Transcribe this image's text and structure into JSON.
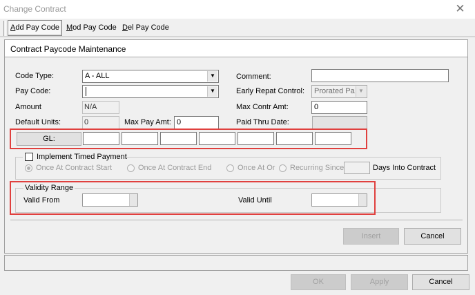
{
  "window": {
    "title": "Change Contract",
    "close_symbol": "✕"
  },
  "toolbar": {
    "add_label": "Add Pay Code",
    "mod_label": "Mod Pay Code",
    "del_label": "Del Pay Code"
  },
  "panel": {
    "title": "Contract Paycode Maintenance"
  },
  "form": {
    "code_type_label": "Code Type:",
    "code_type_value": "A - ALL",
    "pay_code_label": "Pay Code:",
    "pay_code_value": "",
    "amount_label": "Amount",
    "amount_value": "N/A",
    "default_units_label": "Default Units:",
    "default_units_value": "0",
    "max_pay_amt_label": "Max Pay Amt:",
    "max_pay_amt_value": "0",
    "comment_label": "Comment:",
    "comment_value": "",
    "early_repat_label": "Early Repat Control:",
    "early_repat_value": "Prorated Pa",
    "max_contr_amt_label": "Max Contr Amt:",
    "max_contr_amt_value": "0",
    "paid_thru_label": "Paid Thru Date:",
    "paid_thru_value": "",
    "gl_button_label": "GL:",
    "gl_segments": [
      "",
      "",
      "",
      "",
      "",
      "",
      ""
    ]
  },
  "timed_payment": {
    "checkbox_label": "Implement Timed Payment",
    "checked": false,
    "options": [
      "Once At Contract Start",
      "Once At Contract End",
      "Once At Or",
      "Recurring Since"
    ],
    "selected_option": "Once At Contract Start",
    "days_value": "",
    "days_label": "Days Into Contract"
  },
  "validity": {
    "group_label": "Validity Range",
    "valid_from_label": "Valid From",
    "valid_from_value": "",
    "valid_until_label": "Valid Until",
    "valid_until_value": ""
  },
  "panel_buttons": {
    "insert_label": "Insert",
    "cancel_label": "Cancel"
  },
  "footer_buttons": {
    "ok_label": "OK",
    "apply_label": "Apply",
    "cancel_label": "Cancel"
  },
  "colors": {
    "highlight": "#e0403e",
    "background": "#f0f0f0"
  }
}
